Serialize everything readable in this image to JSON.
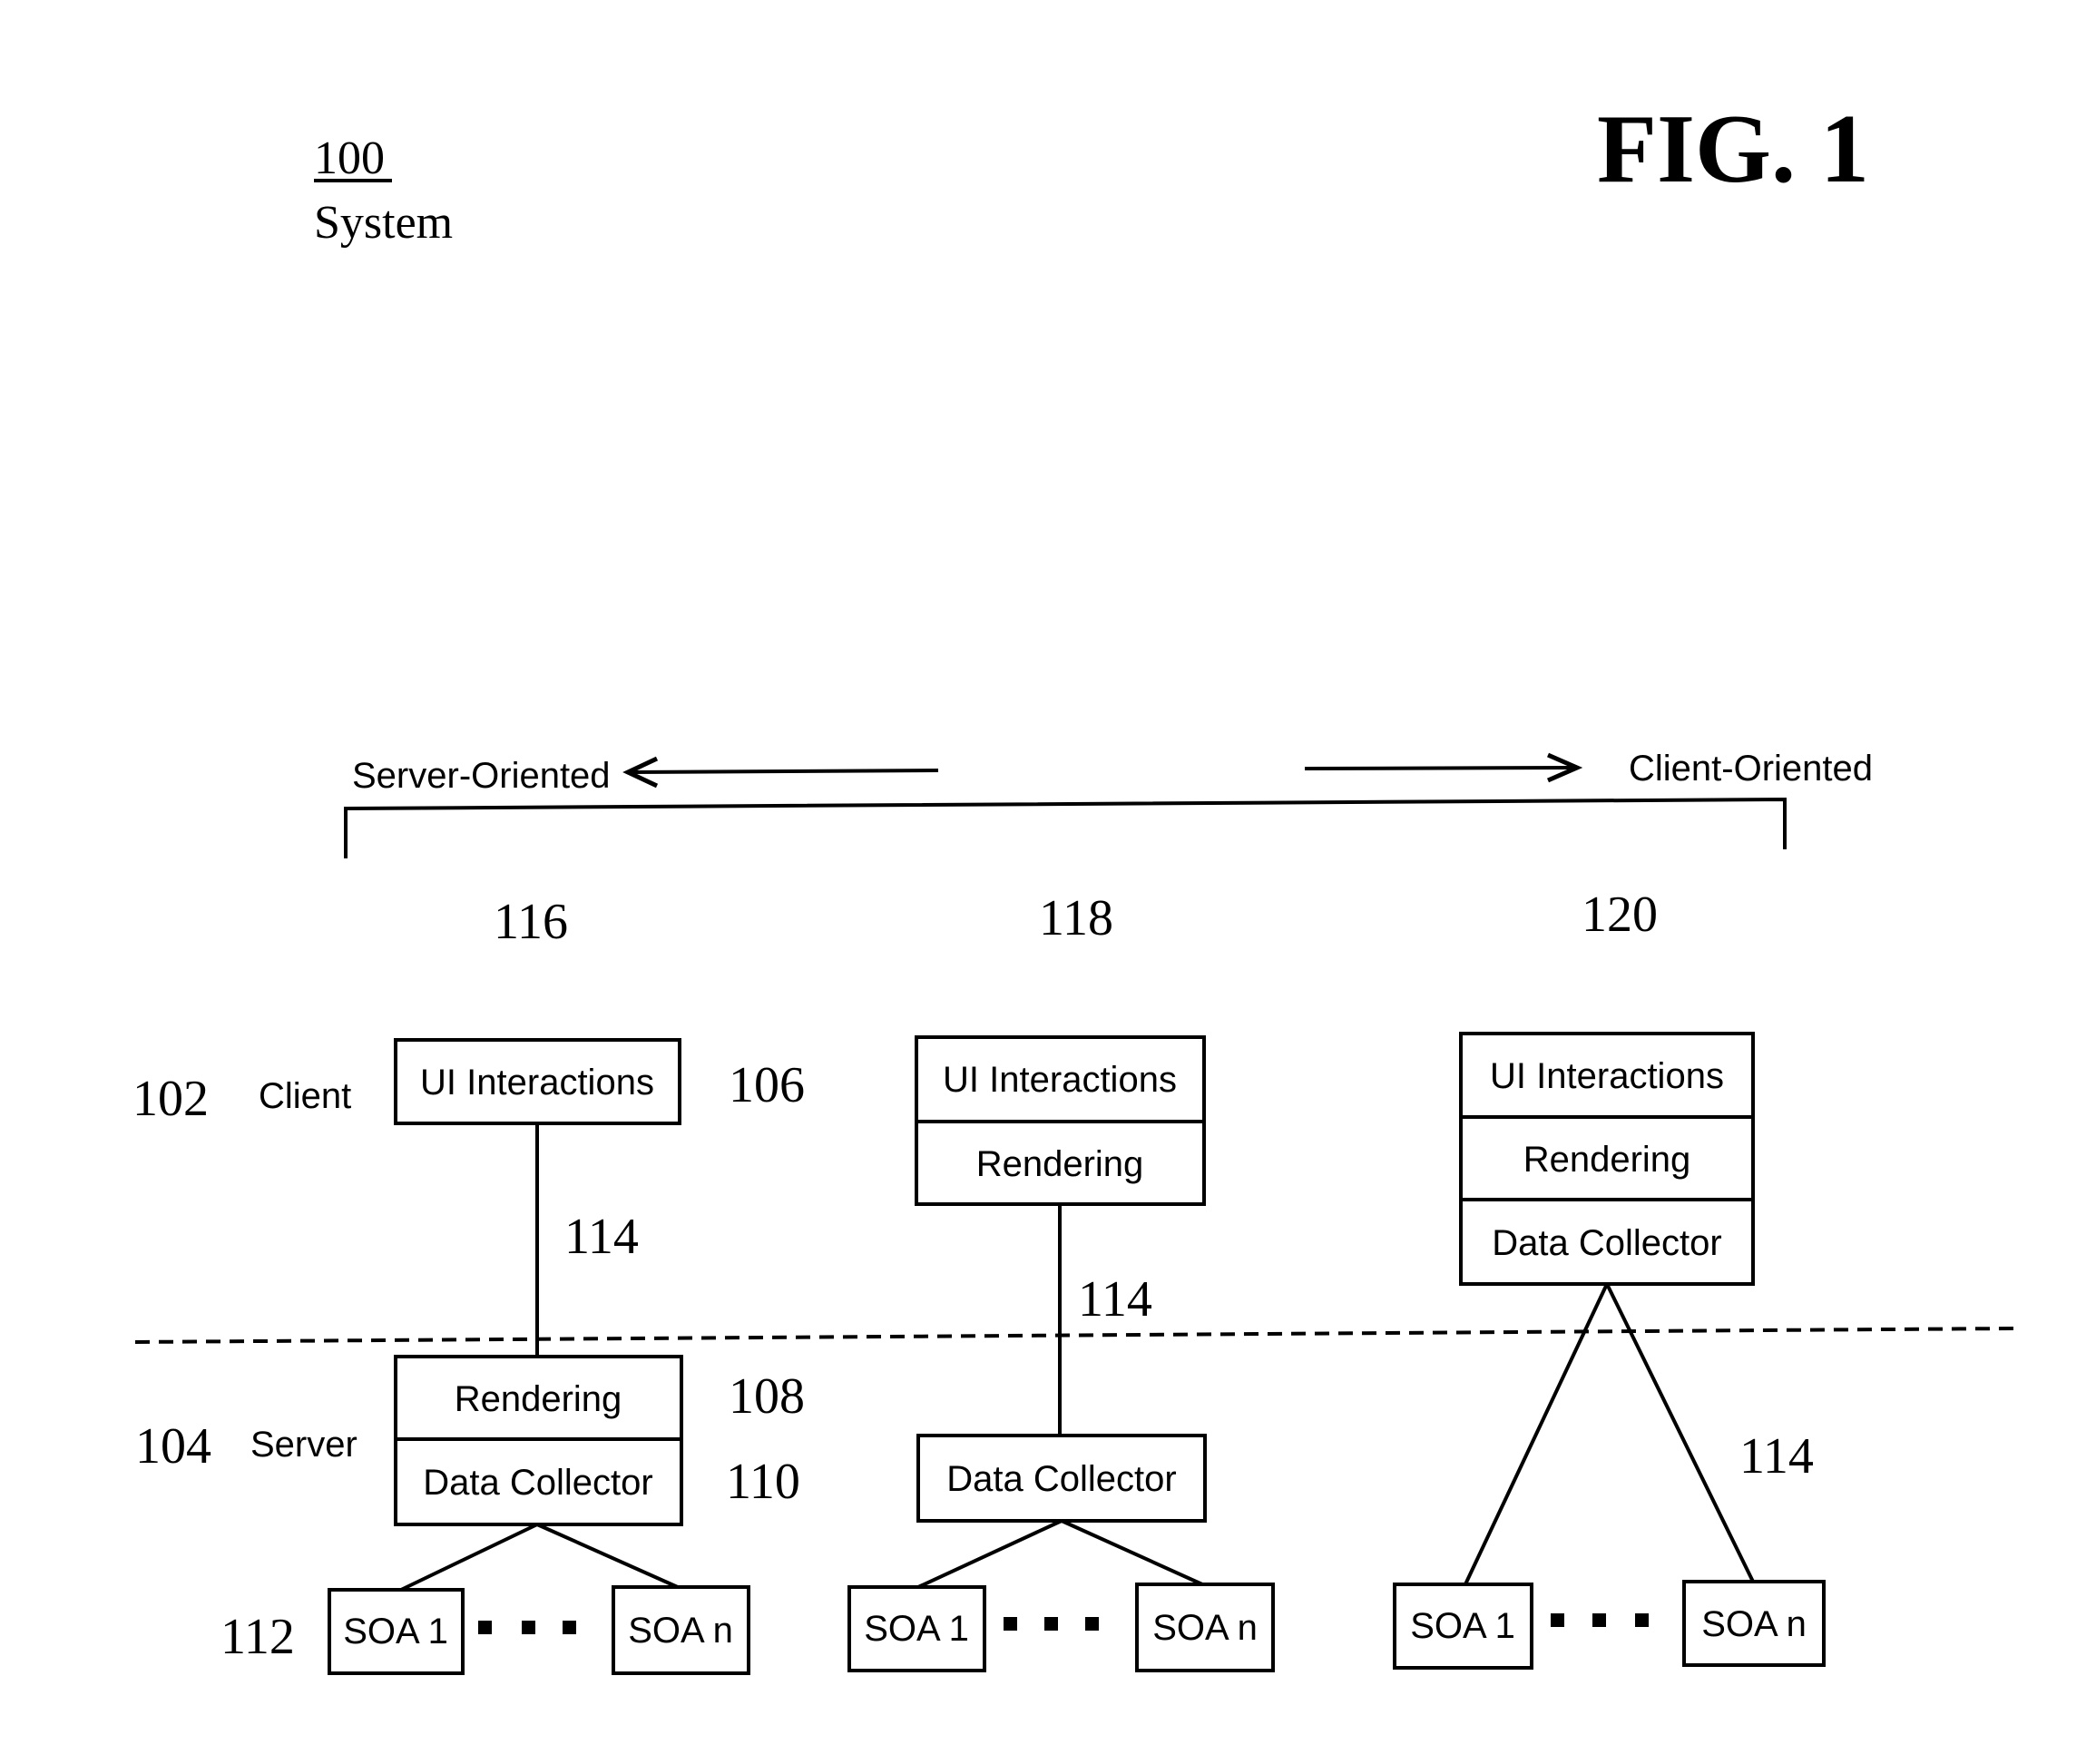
{
  "header": {
    "ref_number": "100",
    "ref_label": "System",
    "figure_title": "FIG. 1"
  },
  "spectrum": {
    "left_label": "Server-Oriented",
    "right_label": "Client-Oriented",
    "left_arrow_icon": "arrow-left-icon",
    "right_arrow_icon": "arrow-right-icon"
  },
  "tiers": {
    "client": {
      "ref": "102",
      "label": "Client"
    },
    "server": {
      "ref": "104",
      "label": "Server"
    }
  },
  "columns": [
    {
      "ref": "116",
      "client_components": [
        "UI Interactions"
      ],
      "server_components": [
        "Rendering",
        "Data Collector"
      ],
      "connection_ref": "114",
      "component_refs": {
        "ui": "106",
        "rendering": "108",
        "data_collector": "110",
        "soa": "112"
      },
      "soa_first": "SOA 1",
      "soa_last": "SOA n"
    },
    {
      "ref": "118",
      "client_components": [
        "UI Interactions",
        "Rendering"
      ],
      "server_components": [
        "Data Collector"
      ],
      "connection_ref": "114",
      "soa_first": "SOA 1",
      "soa_last": "SOA n"
    },
    {
      "ref": "120",
      "client_components": [
        "UI Interactions",
        "Rendering",
        "Data Collector"
      ],
      "server_components": [],
      "connection_ref": "114",
      "soa_first": "SOA 1",
      "soa_last": "SOA n"
    }
  ]
}
